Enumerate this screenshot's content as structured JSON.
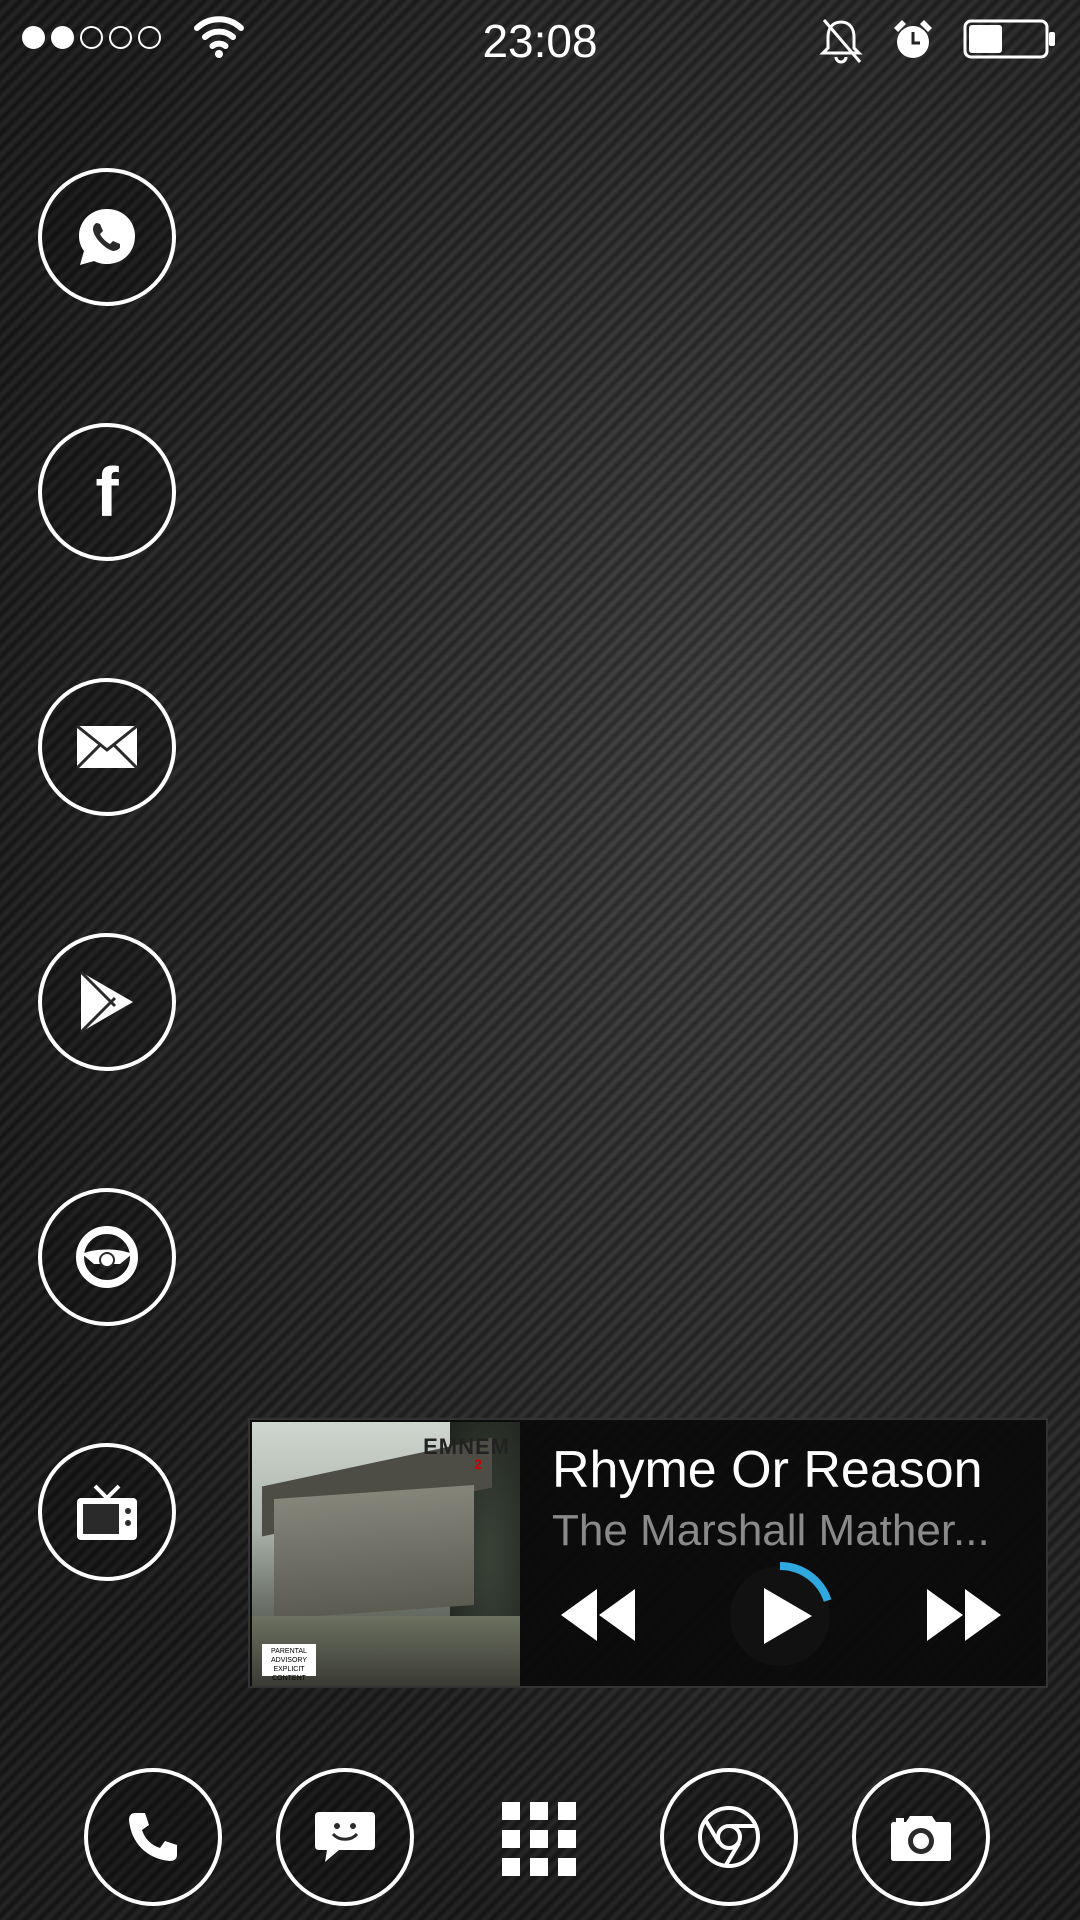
{
  "status_bar": {
    "time": "23:08",
    "signal_strength": 2,
    "signal_max": 5,
    "battery_level": 0.45,
    "icons": [
      "wifi-icon",
      "bell-off-icon",
      "alarm-icon",
      "battery-icon"
    ]
  },
  "side_apps": [
    {
      "icon": "whatsapp-icon"
    },
    {
      "icon": "facebook-icon",
      "glyph": "f"
    },
    {
      "icon": "mail-icon"
    },
    {
      "icon": "play-store-icon"
    },
    {
      "icon": "steering-wheel-icon"
    },
    {
      "icon": "tv-icon"
    }
  ],
  "music_widget": {
    "title": "Rhyme Or Reason",
    "album": "The Marshall Mather...",
    "album_art_label": "EMNEM",
    "album_art_sublabel": "2",
    "advisory_text": "PARENTAL ADVISORY EXPLICIT CONTENT",
    "progress": 0.2,
    "accent_color": "#2fa8e0"
  },
  "dock": [
    {
      "icon": "phone-icon"
    },
    {
      "icon": "messaging-icon"
    },
    {
      "icon": "app-drawer-icon"
    },
    {
      "icon": "chrome-icon"
    },
    {
      "icon": "camera-icon"
    }
  ]
}
